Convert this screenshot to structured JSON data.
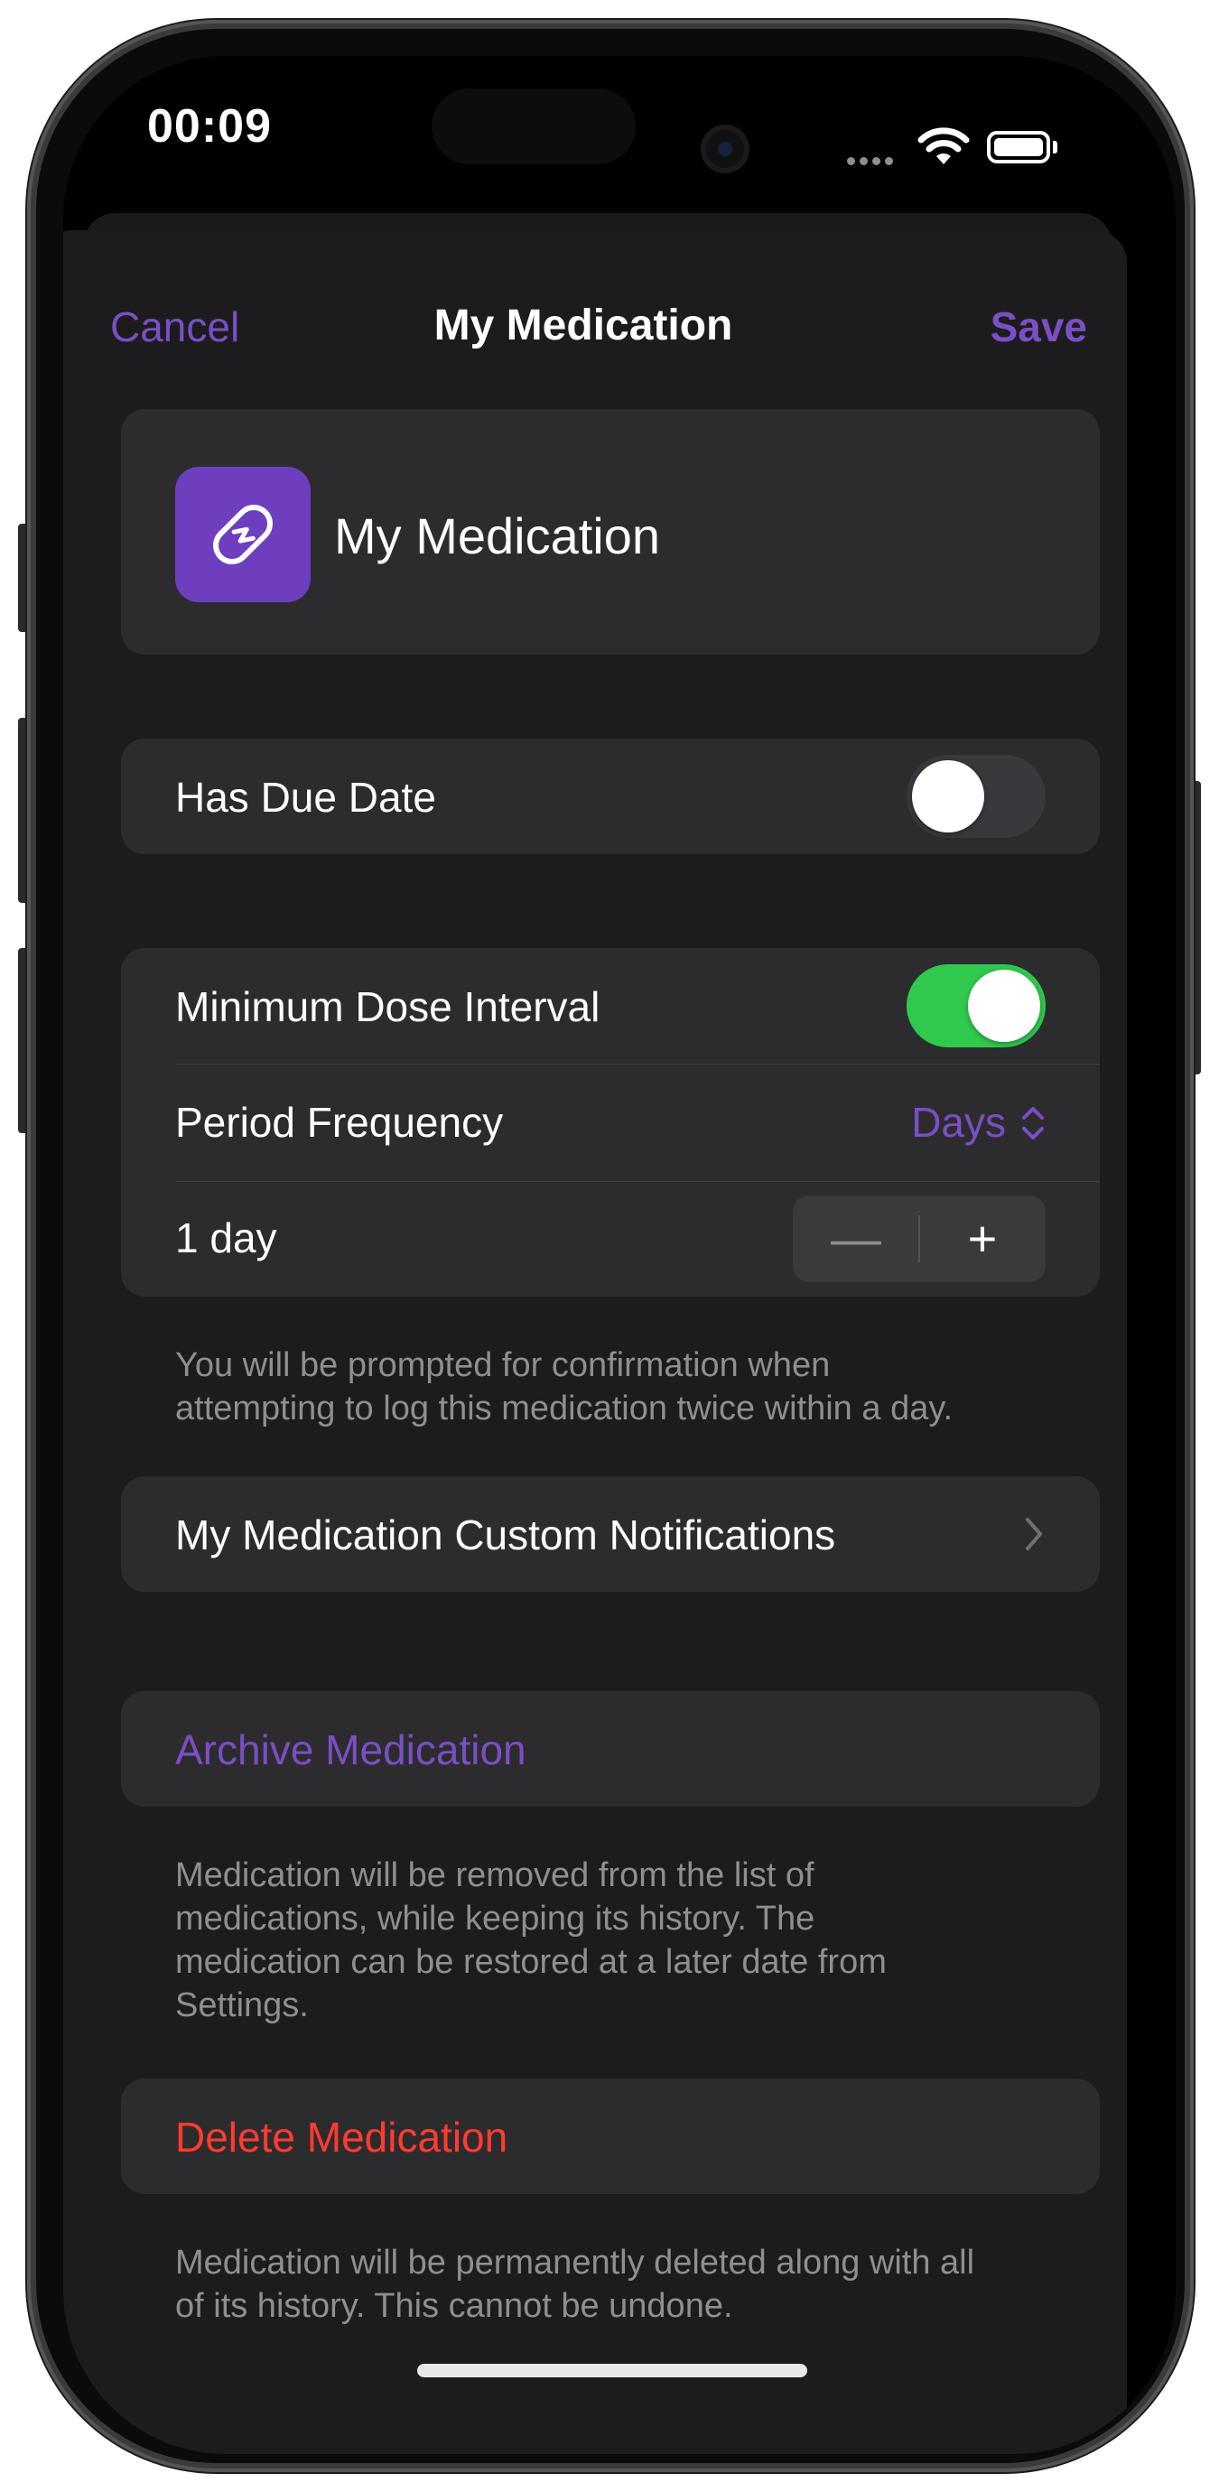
{
  "status_bar": {
    "time": "00:09"
  },
  "nav": {
    "cancel": "Cancel",
    "title": "My Medication",
    "save": "Save"
  },
  "header": {
    "name": "My Medication",
    "icon": "pill-icon"
  },
  "due_date": {
    "label": "Has Due Date",
    "enabled": false
  },
  "dose_interval": {
    "label": "Minimum Dose Interval",
    "enabled": true,
    "period_label": "Period Frequency",
    "period_value": "Days",
    "amount_label": "1 day",
    "footnote_line1": "You will be prompted for confirmation when",
    "footnote_line2": "attempting to log this medication twice within a day."
  },
  "notifications": {
    "label": "My Medication Custom Notifications"
  },
  "archive": {
    "label": "Archive Medication",
    "footnote_line1": "Medication will be removed from the list of",
    "footnote_line2": "medications, while keeping its history. The",
    "footnote_line3": "medication can be restored at a later date from",
    "footnote_line4": "Settings."
  },
  "delete": {
    "label": "Delete Medication",
    "footnote_line1": "Medication will be permanently deleted along with all",
    "footnote_line2": "of its history. This cannot be undone."
  },
  "colors": {
    "accent": "#7a4ec5",
    "destructive": "#ff3b30",
    "toggle_on": "#30c94e"
  }
}
